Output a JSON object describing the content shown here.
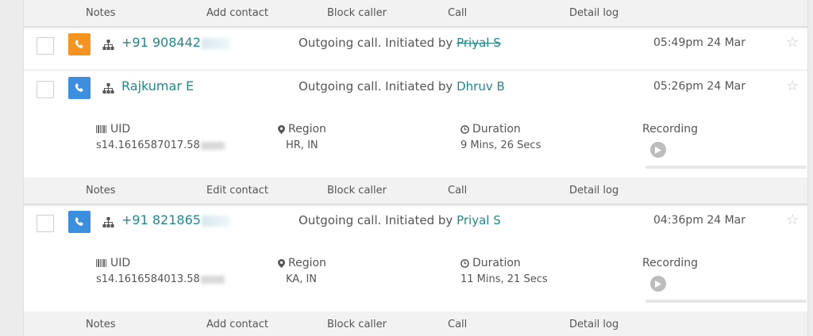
{
  "colors": {
    "orange_call": "#f5941f",
    "blue_call": "#3b8fde",
    "link": "#1f8a8a"
  },
  "icons": {
    "call": "phone-icon",
    "org": "org-chart-icon",
    "star": "star-outline-icon",
    "uid": "barcode-icon",
    "region": "map-pin-icon",
    "duration": "clock-icon",
    "play": "play-icon"
  },
  "top_actions": [
    "Notes",
    "Add contact",
    "Block caller",
    "Call",
    "Detail log"
  ],
  "records": [
    {
      "contact": "+91 908442",
      "contact_masked": "2755",
      "desc_prefix": "Outgoing call. Initiated by",
      "initiated_by": "Priyal S",
      "time": "05:49pm 24 Mar",
      "call_type": "orange"
    },
    {
      "contact": "Rajkumar E",
      "desc_prefix": "Outgoing call. Initiated by",
      "initiated_by": "Dhruv B",
      "time": "05:26pm 24 Mar",
      "call_type": "blue",
      "details": {
        "uid_label": "UID",
        "uid_value": "s14.1616587017.58",
        "region_label": "Region",
        "region_value": "HR, IN",
        "duration_label": "Duration",
        "duration_value": "9 Mins, 26 Secs",
        "recording_label": "Recording",
        "recording_progress": 0
      },
      "actions": [
        "Notes",
        "Edit contact",
        "Block caller",
        "Call",
        "Detail log"
      ]
    },
    {
      "contact": "+91 821865",
      "contact_masked": "3367",
      "desc_prefix": "Outgoing call. Initiated by",
      "initiated_by": "Priyal S",
      "time": "04:36pm 24 Mar",
      "call_type": "blue",
      "details": {
        "uid_label": "UID",
        "uid_value": "s14.1616584013.58",
        "region_label": "Region",
        "region_value": "KA, IN",
        "duration_label": "Duration",
        "duration_value": "11 Mins, 21 Secs",
        "recording_label": "Recording",
        "recording_progress": 0
      },
      "actions": [
        "Notes",
        "Add contact",
        "Block caller",
        "Call",
        "Detail log"
      ]
    }
  ]
}
